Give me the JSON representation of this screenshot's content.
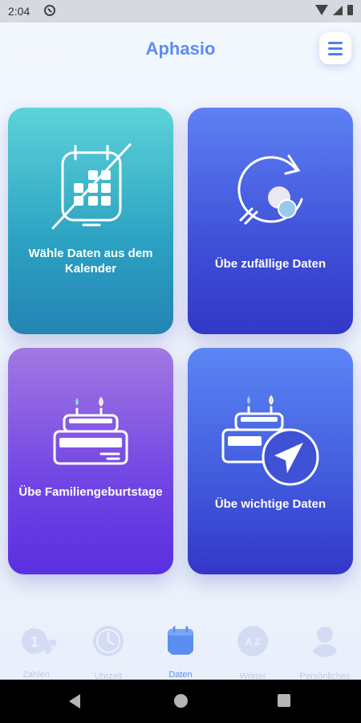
{
  "status": {
    "time": "2:04"
  },
  "app": {
    "title": "Aphasio"
  },
  "cards": [
    {
      "label": "Wähle Daten aus dem Kalender",
      "icon": "calendar-grid-icon"
    },
    {
      "label": "Übe zufällige Daten",
      "icon": "random-cycle-icon"
    },
    {
      "label": "Übe Familiengeburtstage",
      "icon": "birthday-cake-icon"
    },
    {
      "label": "Übe wichtige Daten",
      "icon": "cake-navigation-icon"
    }
  ],
  "nav": [
    {
      "label": "Zahlen",
      "icon": "numbers-icon"
    },
    {
      "label": "Uhrzeit",
      "icon": "clock-icon"
    },
    {
      "label": "Daten",
      "icon": "calendar-icon",
      "active": true
    },
    {
      "label": "Wörter",
      "icon": "az-words-icon"
    },
    {
      "label": "Persönliches",
      "icon": "person-icon"
    }
  ],
  "colors": {
    "accent": "#5b8ef2",
    "nav_inactive": "#c1c9df"
  }
}
